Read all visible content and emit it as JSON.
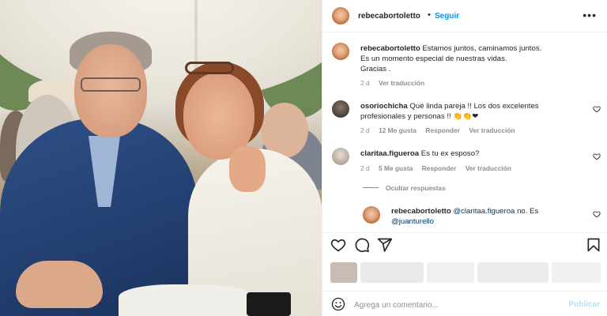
{
  "post": {
    "username": "rebecabortoletto",
    "separator": "•",
    "follow_label": "Seguir",
    "more_icon": "more-horizontal-icon"
  },
  "caption": {
    "username": "rebecabortoletto",
    "line1": "Estamos juntos, caminamos juntos.",
    "line2": "Es un momento especial de nuestras vidas.",
    "line3": "Gracias .",
    "age": "2 d",
    "translate": "Ver traducción"
  },
  "comments": [
    {
      "username": "osoriochicha",
      "text_line1": "Qué linda pareja !! Los dos excelentes",
      "text_line2": "profesionales y personas !!",
      "emojis": "👏👏❤",
      "age": "2 d",
      "likes": "12 Me gusta",
      "reply": "Responder",
      "translate": "Ver traducción"
    },
    {
      "username": "claritaa.figueroa",
      "text": "Es tu ex esposo?",
      "age": "2 d",
      "likes": "5 Me gusta",
      "reply": "Responder",
      "translate": "Ver traducción"
    }
  ],
  "hide_replies": "Ocultar respuestas",
  "reply": {
    "username": "rebecabortoletto",
    "mention": "@claritaa.figueroa",
    "text": "no. Es",
    "mention2": "@juanturello"
  },
  "actions": {
    "like_icon": "heart-icon",
    "comment_icon": "comment-icon",
    "share_icon": "share-icon",
    "save_icon": "bookmark-icon"
  },
  "add_comment": {
    "placeholder": "Agrega un comentario...",
    "publish_label": "Publicar",
    "emoji_icon": "emoji-icon"
  },
  "colors": {
    "link_blue": "#0095f6",
    "muted": "#8e8e8e",
    "publish_disabled": "#b2dffc",
    "heart_red": "#ed4956"
  }
}
